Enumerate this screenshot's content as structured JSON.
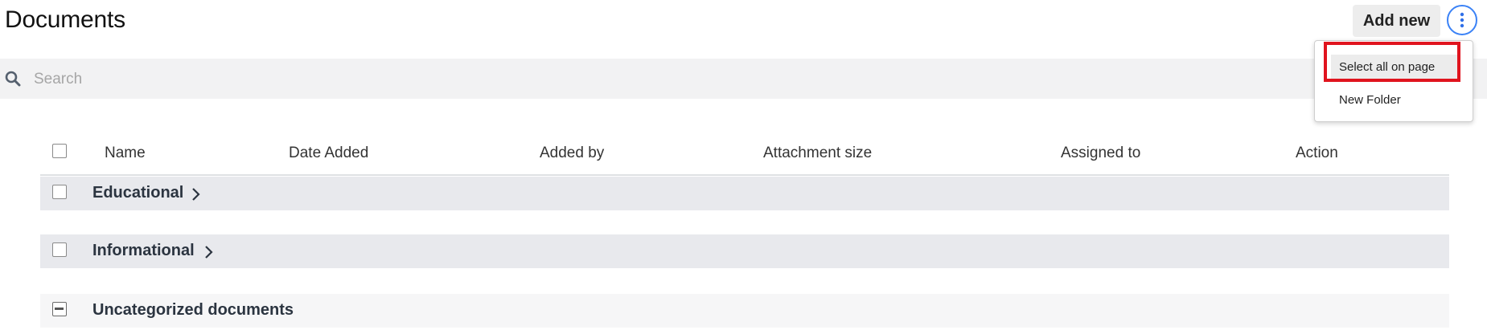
{
  "header": {
    "title": "Documents",
    "add_new_label": "Add new"
  },
  "menu": {
    "items": [
      {
        "label": "Select all on page"
      },
      {
        "label": "New Folder"
      }
    ]
  },
  "search": {
    "placeholder": "Search",
    "value": ""
  },
  "table": {
    "columns": [
      "Name",
      "Date Added",
      "Added by",
      "Attachment size",
      "Assigned to",
      "Action"
    ],
    "folders": [
      {
        "name": "Educational",
        "checked": false
      },
      {
        "name": "Informational",
        "checked": false
      },
      {
        "name": "Uncategorized documents",
        "checked": "indeterminate"
      }
    ]
  },
  "colors": {
    "accent": "#3b82f6",
    "highlight_border": "#e0141e",
    "row_bg": "#e8e9ed",
    "search_bg": "#f2f2f3"
  },
  "icons": [
    "search-icon",
    "more-vertical-icon",
    "chevron-right-icon"
  ]
}
